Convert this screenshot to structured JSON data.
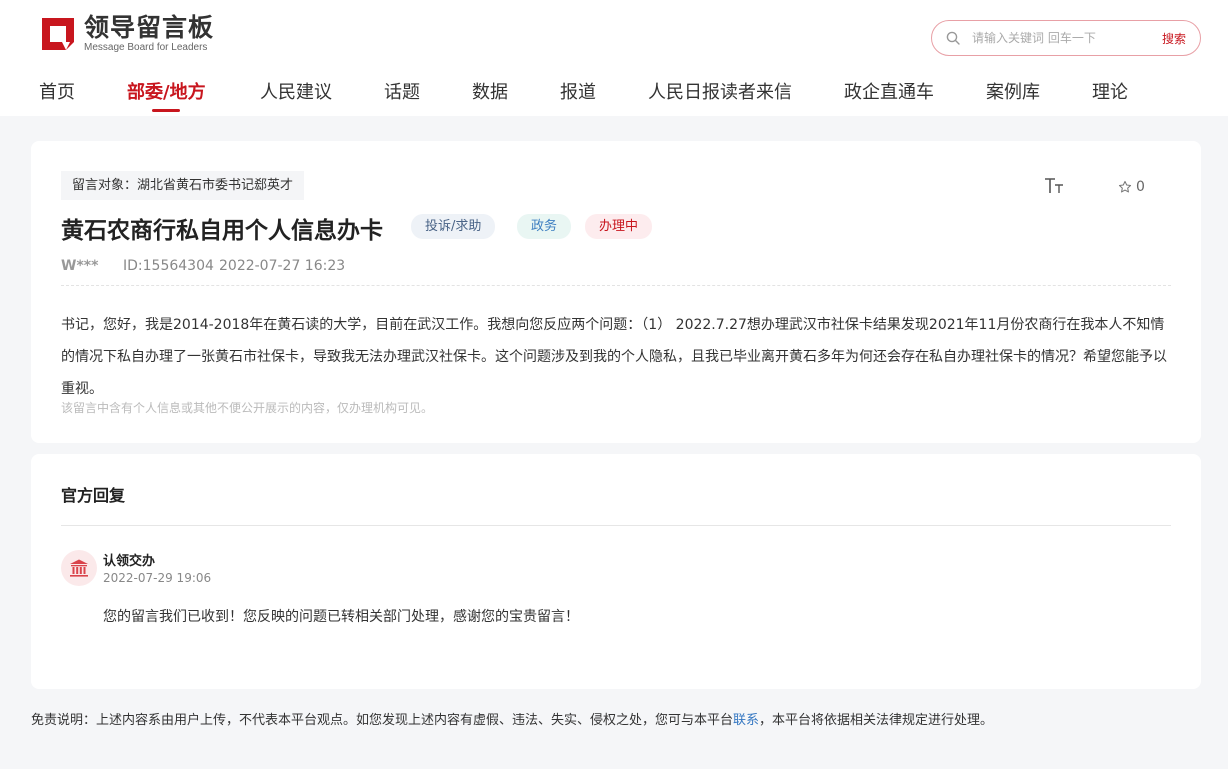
{
  "header": {
    "logo_cn": "领导留言板",
    "logo_en": "Message Board for Leaders",
    "brand_color": "#c8161e",
    "search": {
      "placeholder": "请输入关键词 回车一下",
      "button_label": "搜索"
    }
  },
  "nav": {
    "items": [
      {
        "label": "首页"
      },
      {
        "label": "部委/地方",
        "active": true
      },
      {
        "label": "人民建议"
      },
      {
        "label": "话题"
      },
      {
        "label": "数据"
      },
      {
        "label": "报道"
      },
      {
        "label": "人民日报读者来信"
      },
      {
        "label": "政企直通车"
      },
      {
        "label": "案例库"
      },
      {
        "label": "理论"
      }
    ]
  },
  "message": {
    "target": "留言对象：湖北省黄石市委书记郄英才",
    "title": "黄石农商行私自用个人信息办卡",
    "tags": {
      "category": "投诉/求助",
      "field": "政务",
      "status": "办理中"
    },
    "favorite_count": "0",
    "user": "W***",
    "id": "ID:15564304",
    "time": "2022-07-27 16:23",
    "content": "书记，您好，我是2014-2018年在黄石读的大学，目前在武汉工作。我想向您反应两个问题：（1） 2022.7.27想办理武汉市社保卡结果发现2021年11月份农商行在我本人不知情的情况下私自办理了一张黄石市社保卡，导致我无法办理武汉社保卡。这个问题涉及到我的个人隐私，且我已毕业离开黄石多年为何还会存在私自办理社保卡的情况？希望您能予以重视。",
    "notice": "该留言中含有个人信息或其他不便公开展示的内容，仅办理机构可见。"
  },
  "reply": {
    "section_title": "官方回复",
    "name": "认领交办",
    "time": "2022-07-29 19:06",
    "text": "您的留言我们已收到！您反映的问题已转相关部门处理，感谢您的宝贵留言！"
  },
  "disclaimer": {
    "before": "免责说明：上述内容系由用户上传，不代表本平台观点。如您发现上述内容有虚假、违法、失实、侵权之处，您可与本平台",
    "link": "联系",
    "after": "，本平台将依据相关法律规定进行处理。"
  },
  "icons": {
    "logo": "logo-mark-icon",
    "search": "search-icon",
    "font_size": "font-size-icon",
    "favorite": "star-icon",
    "government": "government-building-icon"
  }
}
